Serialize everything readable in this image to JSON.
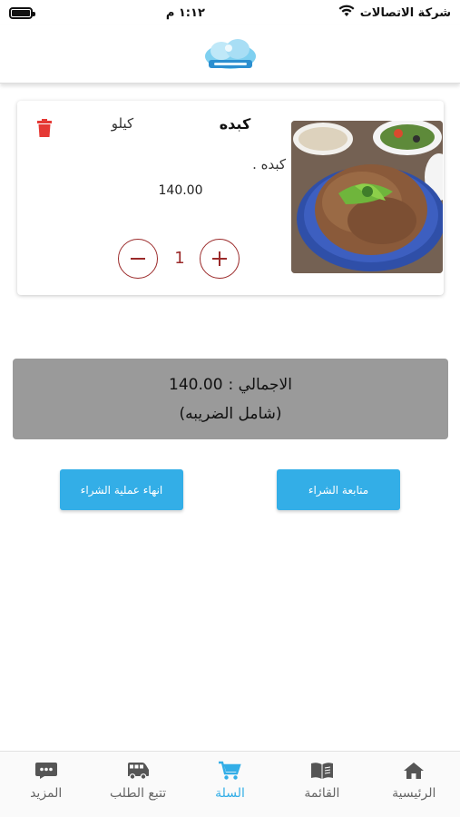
{
  "status_bar": {
    "carrier": "شركة الاتصالات",
    "time": "١:١٢ م"
  },
  "header": {
    "logo": "app-logo"
  },
  "cart": {
    "items": [
      {
        "name": "كبده",
        "unit": "كيلو",
        "description": "كبده .",
        "price": "140.00",
        "quantity": "1"
      }
    ]
  },
  "summary": {
    "total_label": "الاجمالي :",
    "total_value": "140.00",
    "tax_note": "(شامل الضريبه)"
  },
  "actions": {
    "continue_label": "متابعة الشراء",
    "finish_label": "انهاء عملية الشراء"
  },
  "bottom_nav": {
    "items": [
      {
        "label": "الرئيسية",
        "icon": "home-icon"
      },
      {
        "label": "القائمة",
        "icon": "menu-book-icon"
      },
      {
        "label": "السلة",
        "icon": "cart-icon"
      },
      {
        "label": "تتبع الطلب",
        "icon": "bus-icon"
      },
      {
        "label": "المزيد",
        "icon": "more-icon"
      }
    ],
    "active_index": 2
  },
  "colors": {
    "accent": "#33aee7",
    "qty_color": "#9b2a2a",
    "delete_color": "#e53935",
    "total_bg": "#9a9a9a"
  }
}
